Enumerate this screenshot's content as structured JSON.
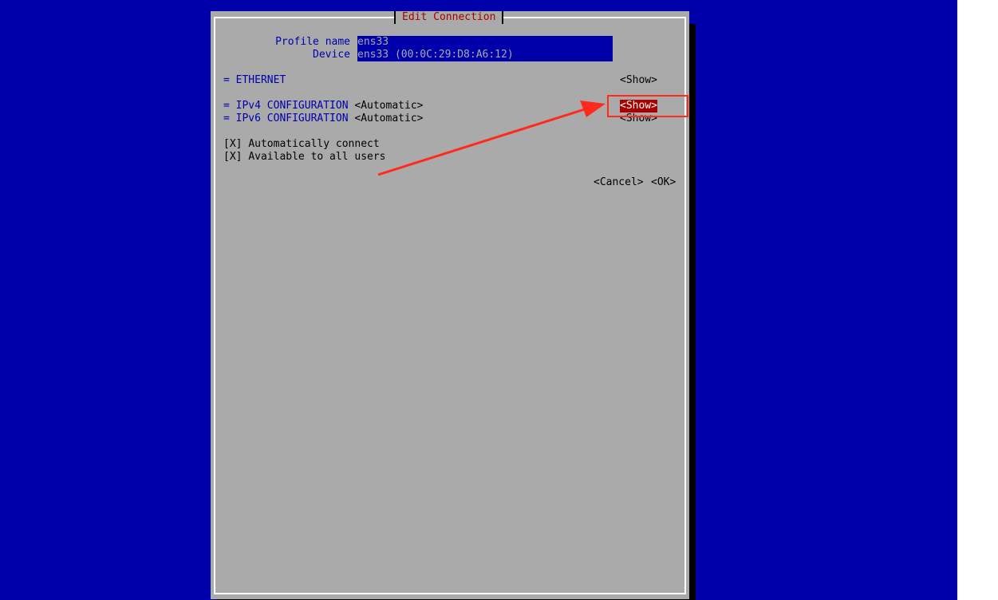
{
  "dialog": {
    "title": "Edit Connection"
  },
  "profile": {
    "label": "Profile name",
    "value": "ens33"
  },
  "device": {
    "label": "Device",
    "value": "ens33 (00:0C:29:D8:A6:12)"
  },
  "sections": {
    "ethernet": {
      "marker": "=",
      "title": "ETHERNET",
      "button": "<Show>"
    },
    "ipv4": {
      "marker": "=",
      "title": "IPv4 CONFIGURATION",
      "mode": "<Automatic>",
      "button": "<Show>"
    },
    "ipv6": {
      "marker": "=",
      "title": "IPv6 CONFIGURATION",
      "mode": "<Automatic>",
      "button": "<Show>"
    }
  },
  "options": {
    "auto_connect": {
      "box": "[X]",
      "label": "Automatically connect",
      "checked": true
    },
    "all_users": {
      "box": "[X]",
      "label": "Available to all users",
      "checked": true
    }
  },
  "buttons": {
    "cancel": "<Cancel>",
    "ok": "<OK>"
  },
  "annotation": {
    "color": "#ff2a1a",
    "target": "ipv4-show-button"
  },
  "colors": {
    "background": "#0000aa",
    "dialog": "#aaaaaa",
    "title": "#aa0000",
    "focus": "#aa0000"
  }
}
